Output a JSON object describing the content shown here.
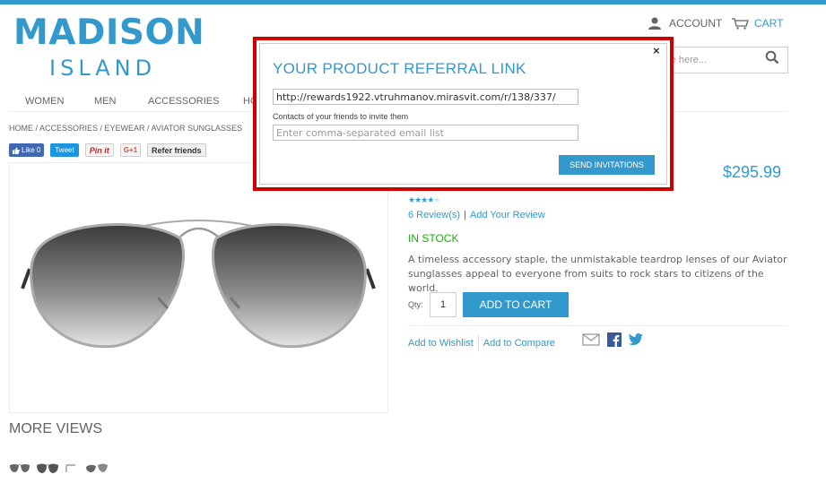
{
  "header": {
    "logo_main": "MADISON",
    "logo_sub": "ISLAND",
    "account_label": "ACCOUNT",
    "cart_label": "CART",
    "search_placeholder": "re here..."
  },
  "nav": {
    "items": [
      "WOMEN",
      "MEN",
      "ACCESSORIES",
      "HO"
    ]
  },
  "breadcrumb": "HOME / ACCESSORIES / EYEWEAR / AVIATOR SUNGLASSES",
  "social": {
    "facebook": "Like 0",
    "twitter": "Tweet",
    "pinterest": "Pin it",
    "gplus": "G+1",
    "refer": "Refer friends"
  },
  "product": {
    "price": "$295.99",
    "stars": "★★★★★",
    "rating": 0.8,
    "reviews": "6 Review(s)",
    "review_sep": "|",
    "add_review": "Add Your Review",
    "stock": "IN STOCK",
    "description": "A timeless accessory staple, the unmistakable teardrop lenses of our Aviator sunglasses appeal to everyone from suits to rock stars to citizens of the world.",
    "qty_label": "Qty:",
    "qty_value": "1",
    "add_to_cart": "ADD TO CART",
    "add_to_wishlist": "Add to Wishlist",
    "add_to_compare": "Add to Compare"
  },
  "more_views": "MORE VIEWS",
  "modal": {
    "close": "×",
    "title": "YOUR PRODUCT REFERRAL LINK",
    "url": "http://rewards1922.vtruhmanov.mirasvit.com/r/138/337/",
    "contacts_label": "Contacts of your friends to invite them",
    "email_placeholder": "Enter comma-separated email list",
    "send_button": "SEND INVITATIONS"
  },
  "colors": {
    "accent": "#3399cc",
    "highlight_border": "#cc0000",
    "in_stock": "#11b400"
  }
}
